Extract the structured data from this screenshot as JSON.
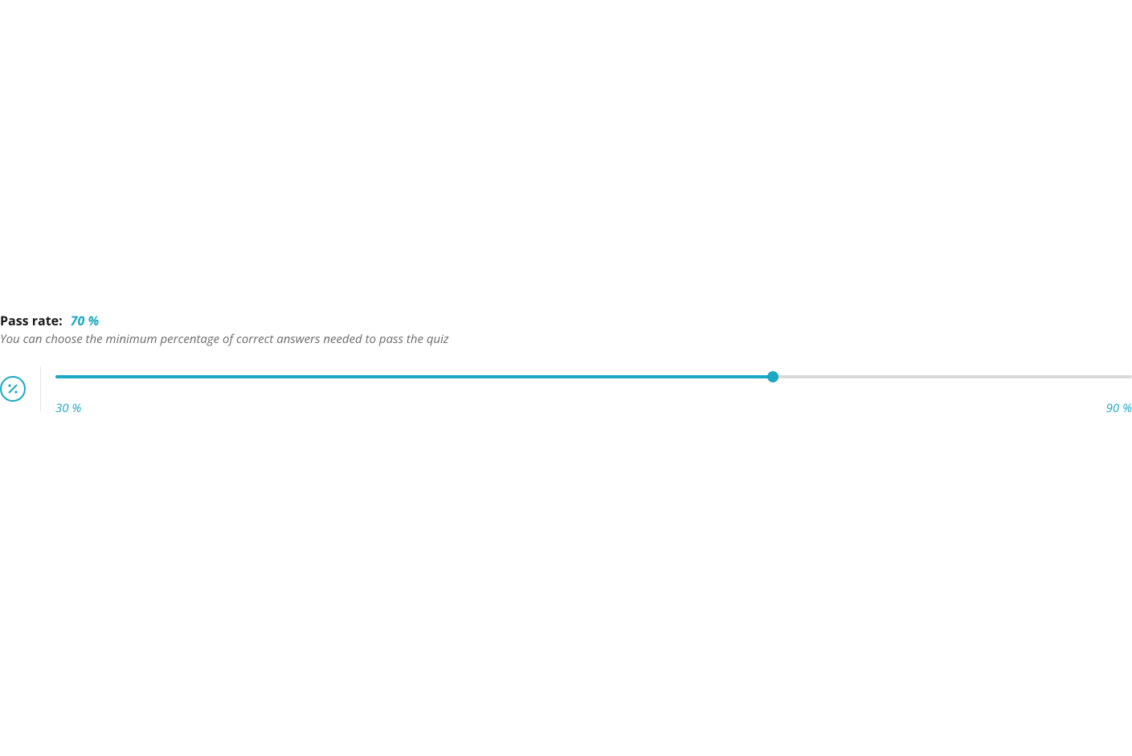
{
  "passRate": {
    "label": "Pass rate:",
    "value": "70 %",
    "description": "You can choose the minimum percentage of correct answers needed to pass the quiz",
    "slider": {
      "min": 30,
      "max": 90,
      "current": 70,
      "minLabel": "30 %",
      "maxLabel": "90 %"
    }
  },
  "colors": {
    "accent": "#1ba8c4"
  }
}
